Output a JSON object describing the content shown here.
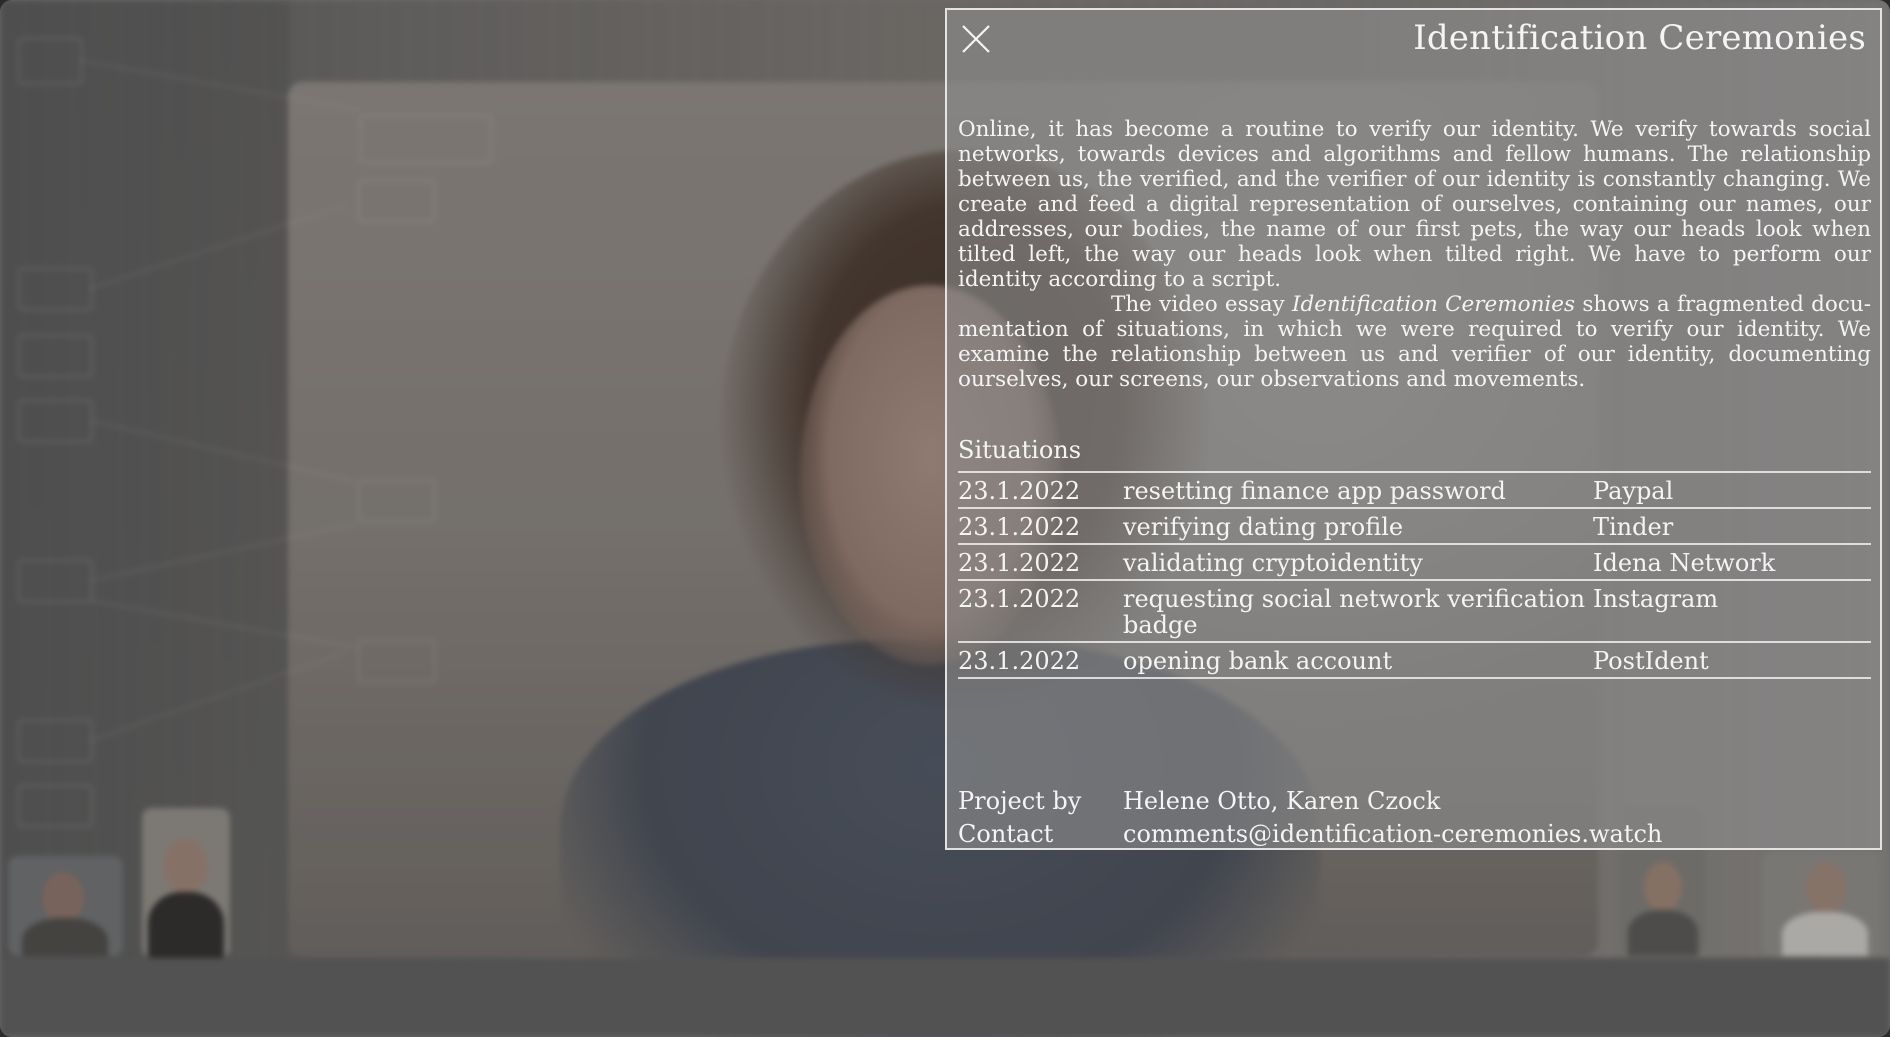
{
  "panel": {
    "title": "Identification Ceremonies",
    "close_icon": "close-icon"
  },
  "intro": {
    "paragraph1": "Online, it has become a routine to verify our identity. We verify towards social networks, towards devices and algorithms and fellow humans. The relationship between us, the verified, and the verifier of our identity is constantly changing. We create and feed a digital representation of ourselves, containing our names, our addresses, our bodies, the name of our first pets, the way our heads look when tilted left, the way our heads look when tilted right. We have to perform our identity according to a script.",
    "paragraph2_before": "The video essay ",
    "paragraph2_title": "Identification Ceremonies",
    "paragraph2_after": " shows a fragmented docu­mentation of situations, in which we were required to verify our identity. We examine the relationship between us and verifier of our identity, documenting ourselves, our screens, our observations and movements."
  },
  "situations": {
    "heading": "Situations",
    "rows": [
      {
        "date": "23.1.2022",
        "activity": "resetting finance app password",
        "platform": "Paypal"
      },
      {
        "date": "23.1.2022",
        "activity": "verifying dating profile",
        "platform": "Tinder"
      },
      {
        "date": "23.1.2022",
        "activity": "validating cryptoidentity",
        "platform": "Idena Network"
      },
      {
        "date": "23.1.2022",
        "activity": "requesting social network verification badge",
        "platform": "Instagram"
      },
      {
        "date": "23.1.2022",
        "activity": "opening bank account",
        "platform": "PostIdent"
      }
    ]
  },
  "credits": {
    "project_label": "Project by",
    "project_value": "Helene Otto, Karen Czock",
    "contact_label": "Contact",
    "contact_value": "comments@identification-ceremonies.watch"
  },
  "colors": {
    "panel_text": "#f4f4f4",
    "panel_border": "#f5f5f5",
    "panel_fill": "#8c8c8c"
  }
}
